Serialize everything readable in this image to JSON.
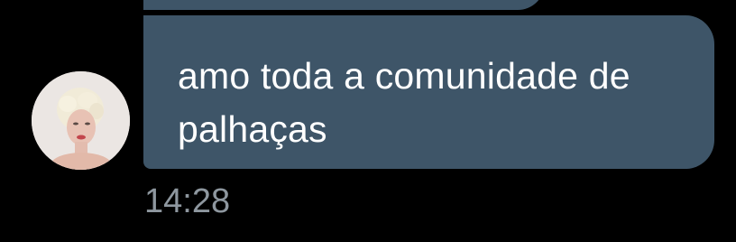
{
  "message": {
    "text": "amo toda a comunidade de palhaças",
    "time": "14:28",
    "sender_avatar": "avatar-photo"
  },
  "colors": {
    "background": "#000000",
    "bubble": "#3e5568",
    "message_text": "#ffffff",
    "timestamp": "#8e979f"
  }
}
